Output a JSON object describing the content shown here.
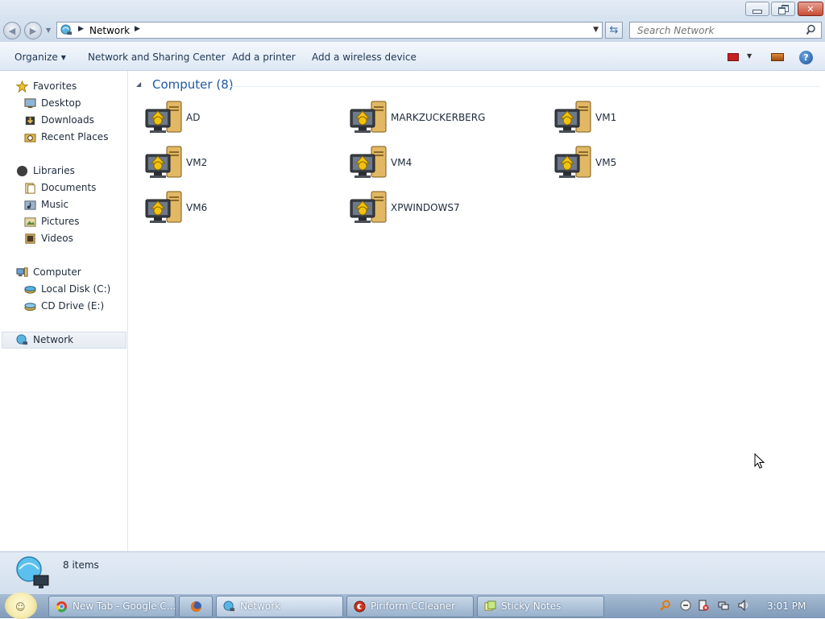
{
  "window": {
    "minimize_label": "",
    "maximize_label": "",
    "close_label": "✕"
  },
  "address": {
    "crumb": "Network",
    "search_placeholder": "Search Network"
  },
  "toolbar": {
    "organize": "Organize",
    "network_sharing": "Network and Sharing Center",
    "add_printer": "Add a printer",
    "add_wireless": "Add a wireless device"
  },
  "nav": {
    "favorites": "Favorites",
    "desktop": "Desktop",
    "downloads": "Downloads",
    "recent": "Recent Places",
    "libraries": "Libraries",
    "documents": "Documents",
    "music": "Music",
    "pictures": "Pictures",
    "videos": "Videos",
    "computer": "Computer",
    "local_disk": "Local Disk (C:)",
    "cd_drive": "CD Drive (E:)",
    "network": "Network"
  },
  "group": {
    "title": "Computer (8)"
  },
  "computers": [
    "AD",
    "MARKZUCKERBERG",
    "VM1",
    "VM2",
    "VM4",
    "VM5",
    "VM6",
    "XPWINDOWS7"
  ],
  "status": {
    "count": "8 items"
  },
  "taskbar": {
    "items": [
      "New Tab - Google C...",
      "",
      "Network",
      "Piriform CCleaner",
      "Sticky Notes"
    ],
    "clock": "3:01 PM"
  }
}
